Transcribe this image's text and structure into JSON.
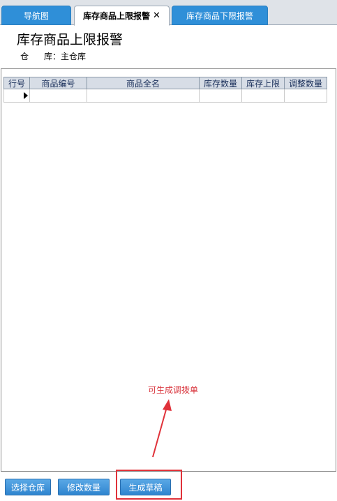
{
  "tabs": [
    {
      "label": "导航图"
    },
    {
      "label": "库存商品上限报警",
      "close": "✕"
    },
    {
      "label": "库存商品下限报警"
    }
  ],
  "header": {
    "title": "库存商品上限报警",
    "warehouse_label_1": "仓",
    "warehouse_label_2": "库：主仓库"
  },
  "grid": {
    "columns": [
      "行号",
      "商品编号",
      "商品全名",
      "库存数量",
      "库存上限",
      "调整数量"
    ]
  },
  "annotation": {
    "text": "可生成调拨单",
    "color": "#d9363e"
  },
  "buttons": {
    "select_warehouse": "选择仓库",
    "modify_quantity": "修改数量",
    "generate_draft": "生成草稿"
  },
  "colors": {
    "tab_blue": "#2f8fd8",
    "button_blue": "#2f85cf",
    "highlight_red": "#e0323a"
  }
}
